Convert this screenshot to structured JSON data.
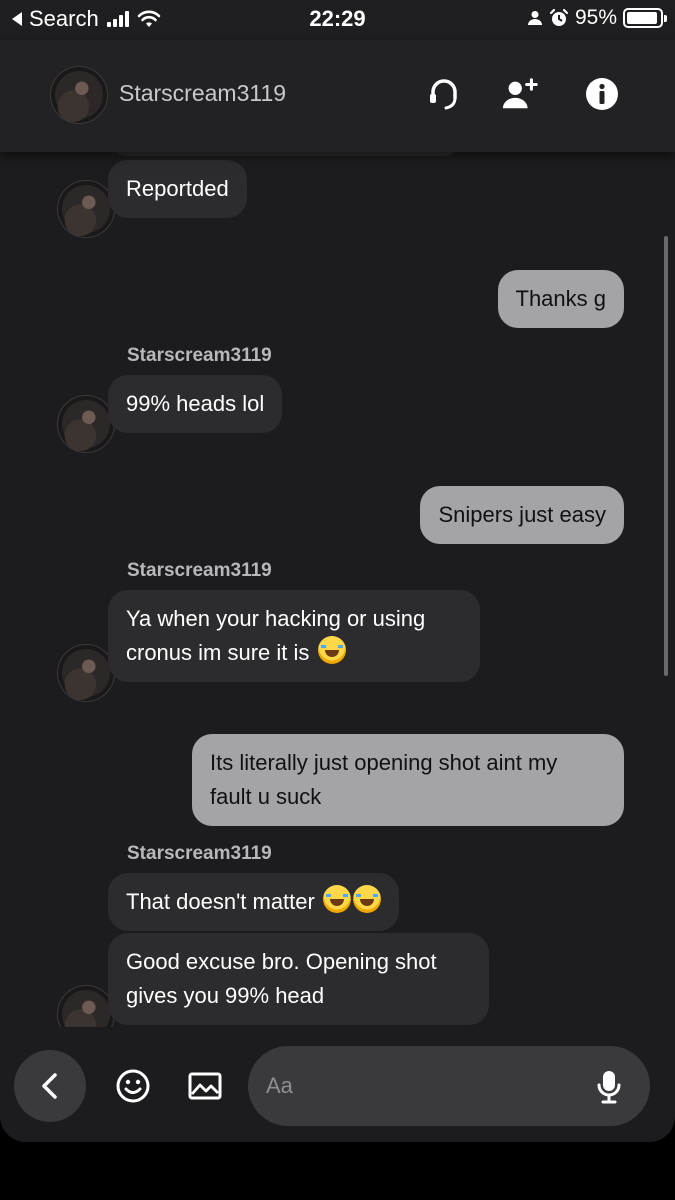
{
  "status_bar": {
    "back_app": "Search",
    "time": "22:29",
    "battery": "95%",
    "battery_level": 0.95
  },
  "header": {
    "contact_name": "Starscream3119",
    "icons": [
      "headset-icon",
      "add-friend-icon",
      "info-icon"
    ]
  },
  "messages": [
    {
      "direction": "in",
      "text": "Reportded"
    },
    {
      "direction": "out",
      "text": "Thanks g"
    },
    {
      "direction": "in",
      "sender": "Starscream3119",
      "text": "99% heads lol"
    },
    {
      "direction": "out",
      "text": "Snipers just easy"
    },
    {
      "direction": "in",
      "sender": "Starscream3119",
      "text_lines": [
        "Ya when your hacking or using",
        "cronus im sure it is"
      ],
      "emoji": "😂"
    },
    {
      "direction": "out",
      "text_lines": [
        "Its literally just opening shot aint my",
        "fault u suck"
      ]
    },
    {
      "direction": "in",
      "sender": "Starscream3119",
      "text": "That doesn't matter",
      "emoji": "😂😂"
    },
    {
      "direction": "in",
      "text_lines": [
        "Good excuse bro. Opening shot",
        "gives you 99% head"
      ]
    }
  ],
  "composer": {
    "placeholder": "Aa",
    "icons": [
      "back-icon",
      "emoji-icon",
      "image-icon",
      "microphone-icon"
    ]
  },
  "colors": {
    "background": "#1c1c1e",
    "incoming_bubble": "#2c2c2e",
    "outgoing_bubble": "#a4a4a8"
  }
}
